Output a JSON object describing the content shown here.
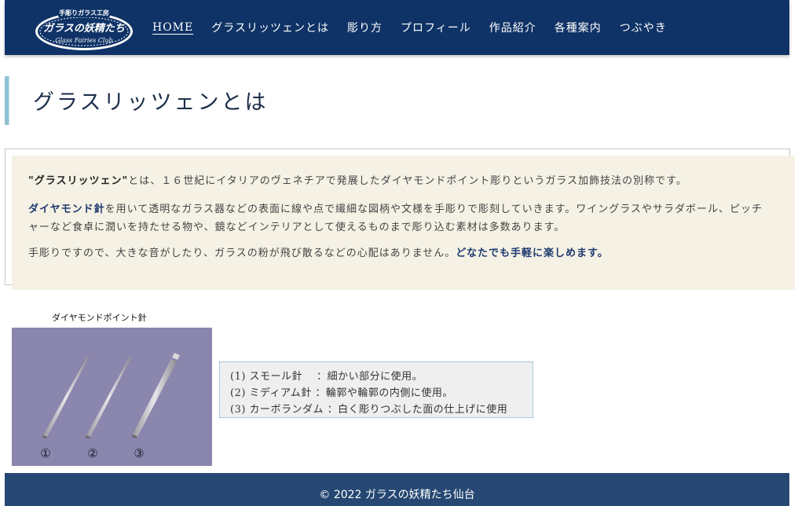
{
  "header": {
    "logo_top_text": "手彫りガラス工房",
    "logo_main_text": "ガラスの妖精たち",
    "logo_script_text": "Glass Fairies Club",
    "nav": [
      {
        "label": "HOME"
      },
      {
        "label": "グラスリッツェンとは"
      },
      {
        "label": "彫り方"
      },
      {
        "label": "プロフィール"
      },
      {
        "label": "作品紹介"
      },
      {
        "label": "各種案内"
      },
      {
        "label": "つぶやき"
      }
    ]
  },
  "page": {
    "title": "グラスリッツェンとは"
  },
  "intro": {
    "p1_strong": "\"グラスリッツェン\"",
    "p1_rest": "とは、１６世紀にイタリアのヴェネチアで発展したダイヤモンドポイント彫りというガラス加飾技法の別称です。",
    "p2_strong": "ダイヤモンド針",
    "p2_rest": "を用いて透明なガラス器などの表面に線や点で繊細な図柄や文様を手彫りで彫刻していきます。ワイングラスやサラダボール、ピッチャーなど食卓に潤いを持たせる物や、鏡などインテリアとして使えるものまで彫り込む素材は多数あります。",
    "p3_text": "手彫りですので、大きな音がしたり、ガラスの粉が飛び散るなどの心配はありません。",
    "p3_strong": "どなたでも手軽に楽しめます。"
  },
  "needles": {
    "caption": "ダイヤモンドポイント針",
    "numbers": [
      "①",
      "②",
      "③"
    ],
    "colors": {
      "background": "#8a86ae",
      "needle": "#c8c8cc"
    }
  },
  "info": {
    "lines": [
      "(1) スモール針　 ：細かい部分に使用。",
      "(2) ミディアム針 ：輪郭や輪郭の内側に使用。",
      "(3) カーボランダム ：白く彫りつぶした面の仕上げに使用"
    ]
  },
  "footer": {
    "text": "© 2022 ガラスの妖精たち仙台"
  },
  "colors": {
    "header_bg": "#0f3366",
    "footer_bg": "#264872",
    "intro_bg": "#f5f1e5",
    "title_accent": "#8fc1d4"
  }
}
